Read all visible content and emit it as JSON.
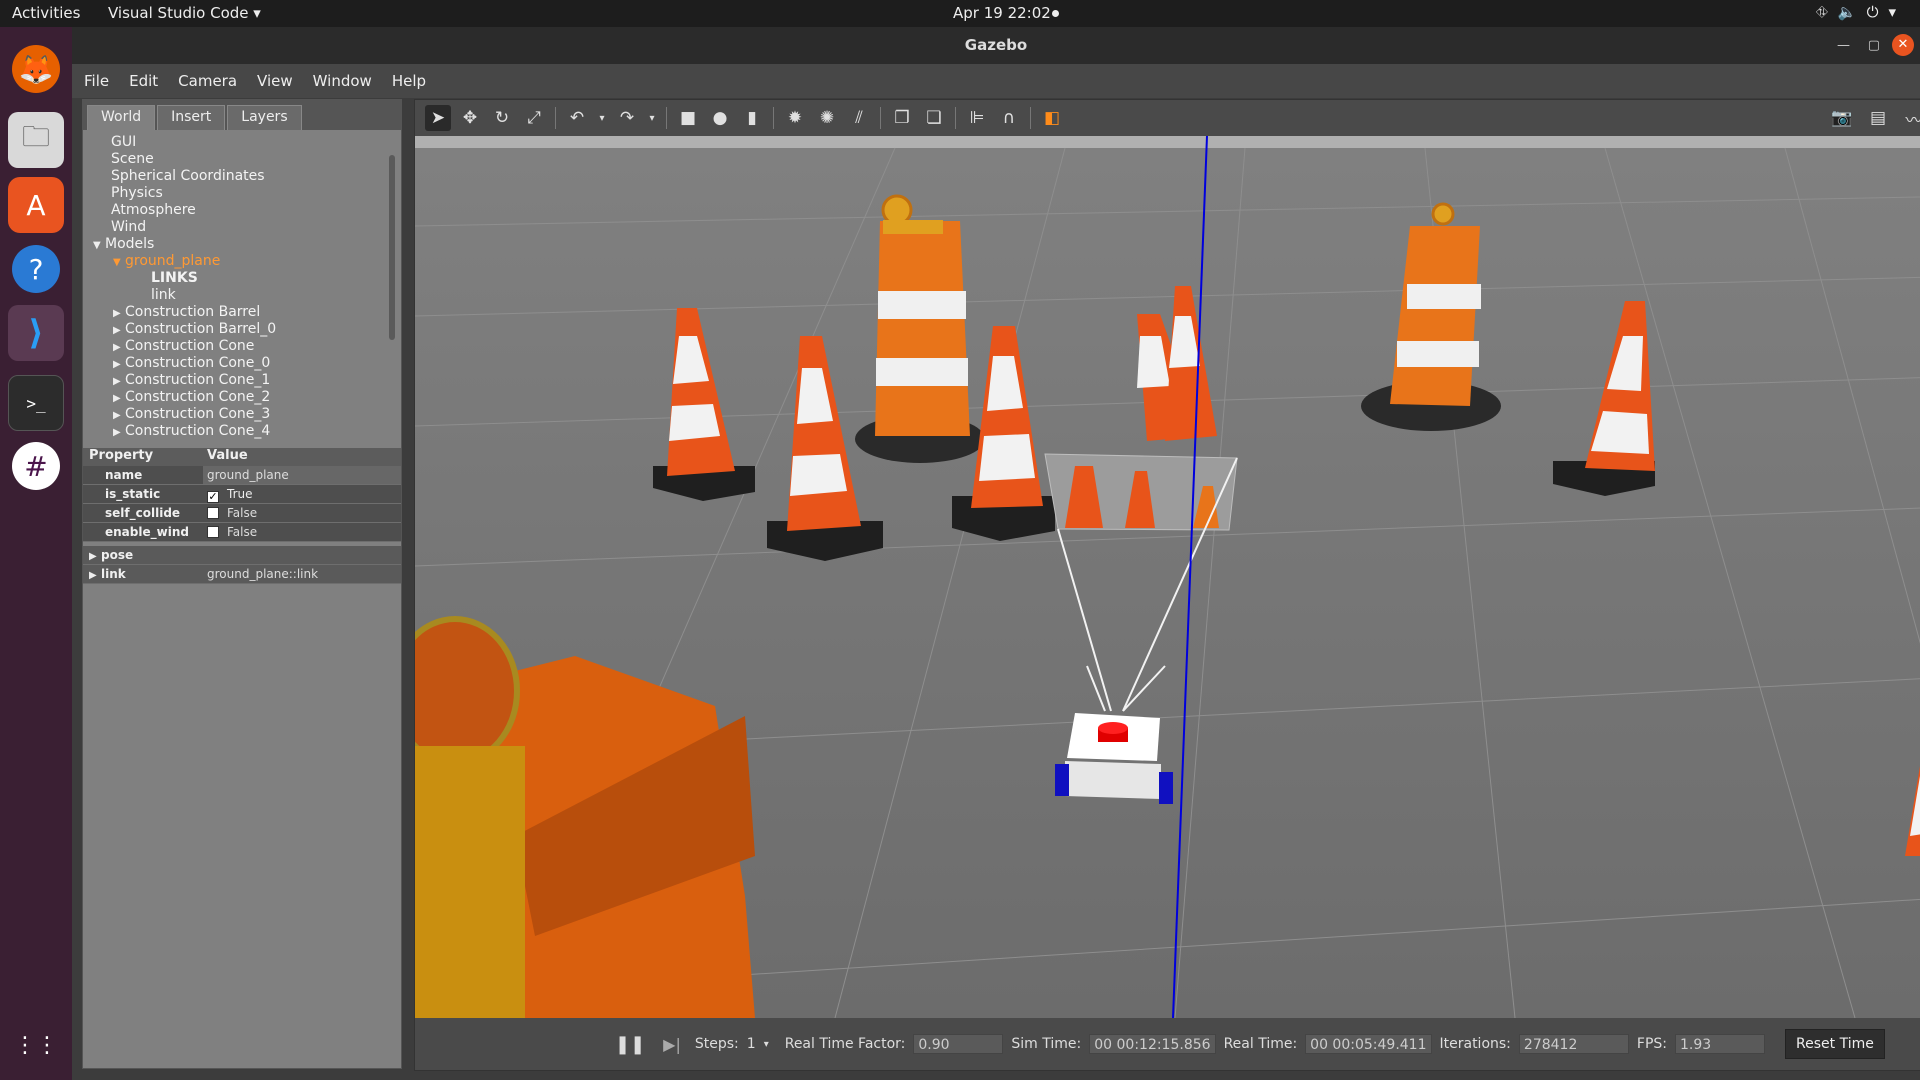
{
  "topbar": {
    "activities": "Activities",
    "app": "Visual Studio Code ▾",
    "clock": "Apr 19  22:02"
  },
  "dock": {
    "items": [
      {
        "name": "firefox",
        "icon": "🦊"
      },
      {
        "name": "files",
        "icon": "🗀"
      },
      {
        "name": "software",
        "icon": "A"
      },
      {
        "name": "help",
        "icon": "?"
      },
      {
        "name": "vscode",
        "icon": "⟩"
      },
      {
        "name": "terminal",
        "icon": ">_"
      },
      {
        "name": "slack",
        "icon": "#"
      },
      {
        "name": "app-grid",
        "icon": "⋮⋮"
      }
    ]
  },
  "window": {
    "title": "Gazebo"
  },
  "menu": {
    "file": "File",
    "edit": "Edit",
    "camera": "Camera",
    "view": "View",
    "window": "Window",
    "help": "Help"
  },
  "tabs": {
    "world": "World",
    "insert": "Insert",
    "layers": "Layers"
  },
  "tree": {
    "gui": "GUI",
    "scene": "Scene",
    "spherical": "Spherical Coordinates",
    "physics": "Physics",
    "atmosphere": "Atmosphere",
    "wind": "Wind",
    "models": "Models",
    "ground_plane": "ground_plane",
    "links": "LINKS",
    "link": "link",
    "items": [
      "Construction Barrel",
      "Construction Barrel_0",
      "Construction Cone",
      "Construction Cone_0",
      "Construction Cone_1",
      "Construction Cone_2",
      "Construction Cone_3",
      "Construction Cone_4"
    ]
  },
  "props": {
    "header_property": "Property",
    "header_value": "Value",
    "rows": [
      {
        "key": "name",
        "value": "ground_plane"
      },
      {
        "key": "is_static",
        "value": "True",
        "check": "✓"
      },
      {
        "key": "self_collide",
        "value": "False",
        "check": ""
      },
      {
        "key": "enable_wind",
        "value": "False",
        "check": ""
      }
    ],
    "pose": "pose",
    "link": "link",
    "link_value": "ground_plane::link"
  },
  "bottom": {
    "steps_label": "Steps:",
    "steps_value": "1",
    "rtf_label": "Real Time Factor:",
    "rtf_value": "0.90",
    "sim_label": "Sim Time:",
    "sim_value": "00 00:12:15.856",
    "real_label": "Real Time:",
    "real_value": "00 00:05:49.411",
    "iter_label": "Iterations:",
    "iter_value": "278412",
    "fps_label": "FPS:",
    "fps_value": "1.93",
    "reset": "Reset Time"
  },
  "colors": {
    "cone_orange": "#e8541a",
    "stripe_white": "#f2f2f2",
    "ground": "#7a7a7a",
    "axis_blue": "#0000dd",
    "selected_orange": "#ff9933"
  }
}
